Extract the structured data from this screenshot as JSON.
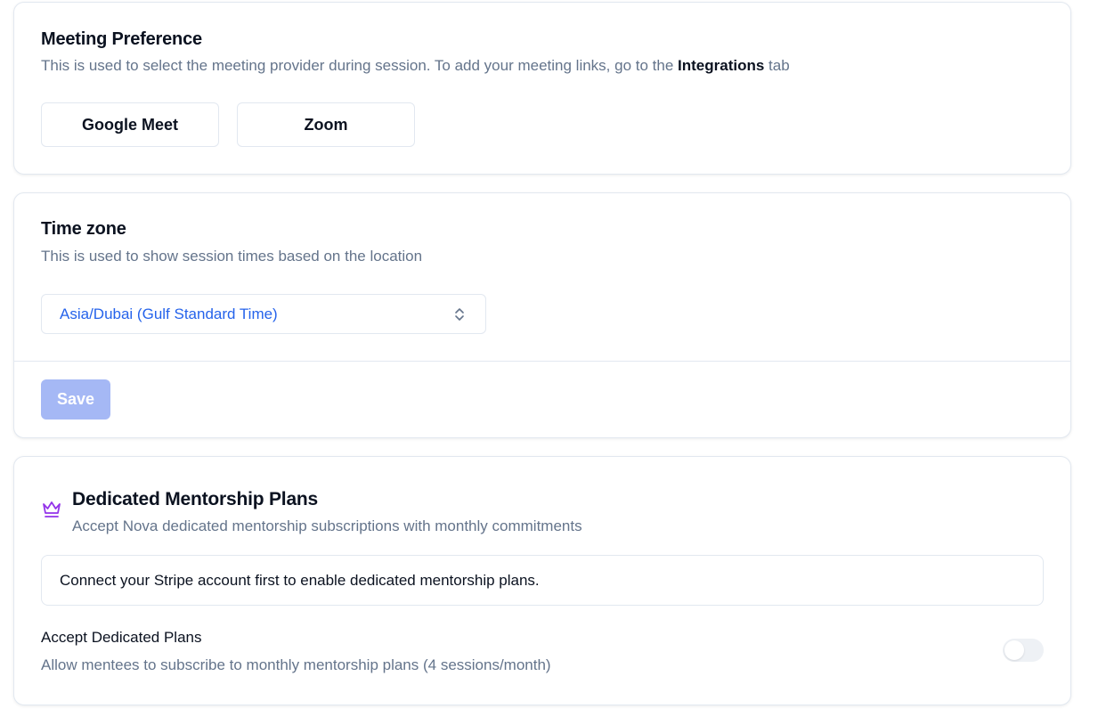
{
  "meeting": {
    "title": "Meeting Preference",
    "description_prefix": "This is used to select the meeting provider during session. To add your meeting links, go to the ",
    "description_link": "Integrations",
    "description_suffix": " tab",
    "providers": [
      "Google Meet",
      "Zoom"
    ]
  },
  "timezone": {
    "title": "Time zone",
    "description": "This is used to show session times based on the location",
    "selected": "Asia/Dubai (Gulf Standard Time)",
    "save_label": "Save"
  },
  "plans": {
    "icon": "crown-icon",
    "title": "Dedicated Mentorship Plans",
    "description": "Accept Nova dedicated mentorship subscriptions with monthly commitments",
    "notice": "Connect your Stripe account first to enable dedicated mentorship plans.",
    "accept_label": "Accept Dedicated Plans",
    "accept_description": "Allow mentees to subscribe to monthly mentorship plans (4 sessions/month)",
    "toggle_on": false
  },
  "colors": {
    "link_blue": "#2563eb",
    "save_disabled": "#a5b8f5",
    "crown_purple": "#9333ea",
    "muted_text": "#64748b"
  }
}
